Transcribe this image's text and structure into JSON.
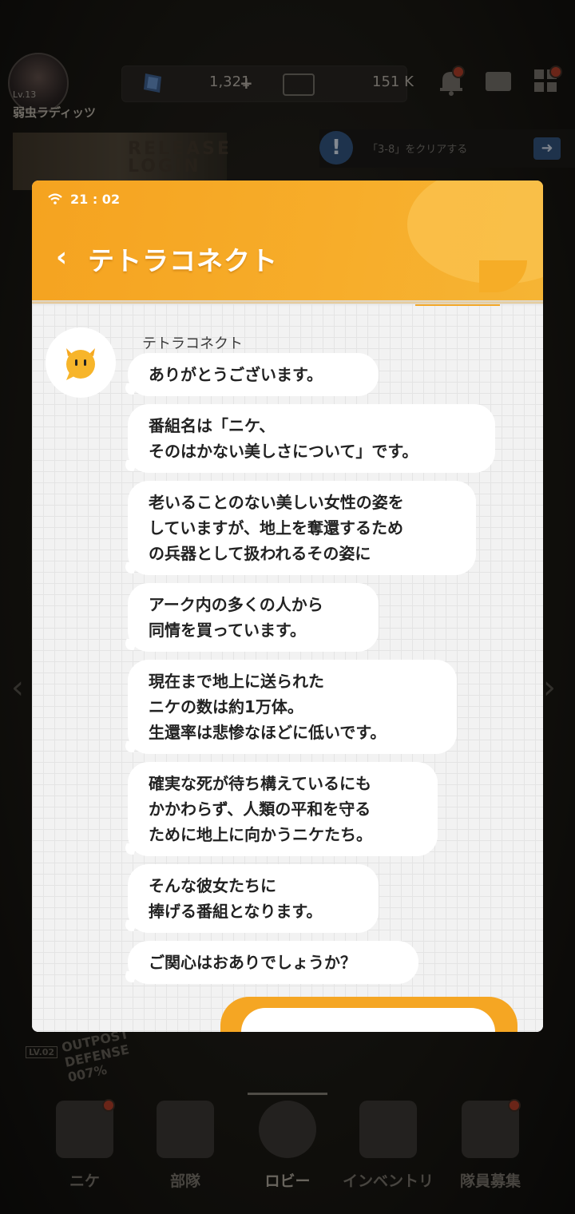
{
  "player": {
    "level": "Lv.13",
    "name": "弱虫ラディッツ"
  },
  "resources": {
    "gems": "1,321",
    "credits": "151 K"
  },
  "banner": {
    "text": "RELEASE\nLOGIN"
  },
  "mission": {
    "text": "「3-8」をクリアする"
  },
  "outpost": {
    "level": "LV.02",
    "label": "OUTPOST DEFENSE 007%"
  },
  "phone": {
    "time": "21 : 02",
    "title": "テトラコネクト",
    "sender": "テトラコネクト",
    "messages": [
      "ありがとうございます。",
      "番組名は「ニケ、\nそのはかない美しさについて」です。",
      "老いることのない美しい女性の姿を\nしていますが、地上を奪還するため\nの兵器として扱われるその姿に",
      "アーク内の多くの人から\n同情を買っています。",
      "現在まで地上に送られた\nニケの数は約1万体。\n生還率は悲惨なほどに低いです。",
      "確実な死が待ち構えているにも\nかかわらず、人類の平和を守る\nために地上に向かうニケたち。",
      "そんな彼女たちに\n捧げる番組となります。",
      "ご関心はおありでしょうか？"
    ]
  },
  "nav": {
    "items": [
      {
        "label": "ニケ",
        "icon": "nikke-icon"
      },
      {
        "label": "部隊",
        "icon": "squad-icon"
      },
      {
        "label": "ロビー",
        "icon": "lobby-icon"
      },
      {
        "label": "インベントリ",
        "icon": "inventory-icon"
      },
      {
        "label": "隊員募集",
        "icon": "recruit-icon"
      }
    ]
  },
  "colors": {
    "accent": "#f5a623",
    "header": "#f7ad2a",
    "bubble": "#ffffff",
    "text": "#222222"
  }
}
